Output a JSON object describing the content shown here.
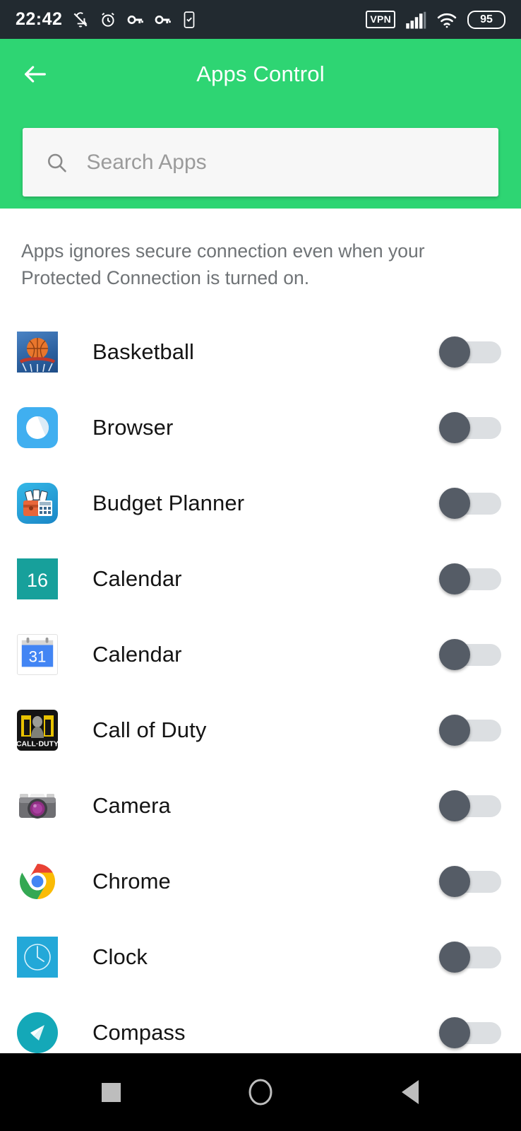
{
  "status_bar": {
    "time": "22:42",
    "left_icons": [
      "bell-off-icon",
      "alarm-clock-icon",
      "key-icon",
      "key-icon",
      "phone-check-icon"
    ],
    "vpn_label": "VPN",
    "right_icons": [
      "vpn-badge",
      "signal-bars-icon",
      "wifi-icon",
      "battery-badge"
    ],
    "battery_level": "95"
  },
  "header": {
    "title": "Apps Control",
    "back_icon": "back-arrow-icon",
    "accent_color": "#2ed573"
  },
  "search": {
    "icon": "search-icon",
    "placeholder": "Search Apps",
    "value": ""
  },
  "main": {
    "description": "Apps ignores secure connection even when your Protected Connection is turned on."
  },
  "apps": [
    {
      "name": "Basketball",
      "icon": "basketball-app-icon",
      "toggle": "off"
    },
    {
      "name": "Browser",
      "icon": "browser-app-icon",
      "toggle": "off"
    },
    {
      "name": "Budget Planner",
      "icon": "budget-planner-app-icon",
      "toggle": "off"
    },
    {
      "name": "Calendar",
      "icon": "calendar-teal-app-icon",
      "toggle": "off",
      "badge": "16"
    },
    {
      "name": "Calendar",
      "icon": "google-calendar-app-icon",
      "toggle": "off",
      "badge": "31"
    },
    {
      "name": "Call of Duty",
      "icon": "call-of-duty-app-icon",
      "toggle": "off",
      "badge": "CALL·DUTY"
    },
    {
      "name": "Camera",
      "icon": "camera-app-icon",
      "toggle": "off"
    },
    {
      "name": "Chrome",
      "icon": "chrome-app-icon",
      "toggle": "off"
    },
    {
      "name": "Clock",
      "icon": "clock-app-icon",
      "toggle": "off"
    },
    {
      "name": "Compass",
      "icon": "compass-app-icon",
      "toggle": "off"
    }
  ],
  "nav_bar": {
    "recents_icon": "square-recents-icon",
    "home_icon": "circle-home-icon",
    "back_icon": "triangle-back-icon"
  }
}
